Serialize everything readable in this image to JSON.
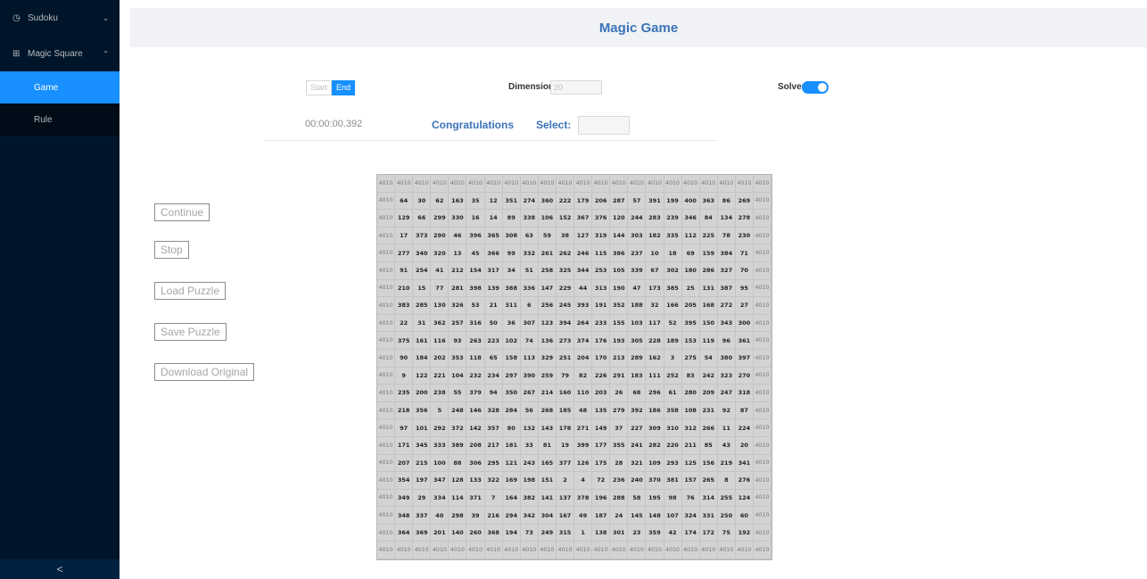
{
  "sidebar": {
    "sudoku": {
      "icon": "clock-icon",
      "glyph": "◷",
      "label": "Sudoku",
      "arrow": "⌄"
    },
    "magic_square": {
      "icon": "grid-icon",
      "glyph": "⊞",
      "label": "Magic Square",
      "arrow": "⌃"
    },
    "items": [
      {
        "label": "Game",
        "active": true
      },
      {
        "label": "Rule",
        "active": false
      }
    ],
    "collapse_glyph": "<"
  },
  "header": {
    "title": "Magic Game"
  },
  "controls": {
    "start_label": "Start",
    "end_label": "End",
    "dimension_label": "Dimension",
    "dimension_value": "20",
    "solver_label": "Solver",
    "solver_on": true,
    "timer": "00:00:00.392",
    "status": "Congratulations",
    "select_label": "Select:",
    "select_value": ""
  },
  "actions": [
    "Continue",
    "Stop",
    "Load Puzzle",
    "Save Puzzle",
    "Download Original"
  ],
  "grid": {
    "border_value": "4010",
    "rows": [
      [
        64,
        30,
        62,
        163,
        35,
        12,
        351,
        274,
        360,
        222,
        179,
        206,
        287,
        57,
        391,
        199,
        400,
        363,
        86,
        269
      ],
      [
        129,
        66,
        299,
        330,
        16,
        14,
        89,
        338,
        106,
        152,
        367,
        376,
        120,
        244,
        283,
        239,
        346,
        84,
        134,
        278
      ],
      [
        17,
        373,
        290,
        46,
        396,
        365,
        308,
        63,
        59,
        38,
        127,
        319,
        144,
        303,
        182,
        335,
        112,
        225,
        78,
        230
      ],
      [
        277,
        340,
        320,
        13,
        45,
        366,
        99,
        332,
        261,
        262,
        246,
        115,
        386,
        237,
        10,
        18,
        69,
        159,
        384,
        71
      ],
      [
        91,
        254,
        41,
        212,
        154,
        317,
        34,
        51,
        258,
        325,
        344,
        253,
        105,
        339,
        67,
        302,
        180,
        286,
        327,
        70
      ],
      [
        210,
        15,
        77,
        281,
        398,
        139,
        388,
        336,
        147,
        229,
        44,
        313,
        190,
        47,
        173,
        385,
        25,
        131,
        387,
        95
      ],
      [
        383,
        285,
        130,
        326,
        53,
        21,
        311,
        6,
        256,
        245,
        393,
        191,
        352,
        188,
        32,
        166,
        205,
        168,
        272,
        27
      ],
      [
        22,
        31,
        362,
        257,
        316,
        50,
        36,
        307,
        123,
        394,
        264,
        233,
        155,
        103,
        117,
        52,
        395,
        150,
        343,
        300
      ],
      [
        375,
        161,
        116,
        93,
        263,
        223,
        102,
        74,
        136,
        273,
        374,
        176,
        193,
        305,
        228,
        189,
        153,
        119,
        96,
        361
      ],
      [
        90,
        184,
        202,
        353,
        118,
        65,
        158,
        113,
        329,
        251,
        204,
        170,
        213,
        289,
        162,
        3,
        275,
        54,
        380,
        397
      ],
      [
        9,
        122,
        221,
        104,
        232,
        234,
        297,
        390,
        259,
        79,
        82,
        226,
        291,
        183,
        111,
        252,
        83,
        242,
        323,
        270
      ],
      [
        235,
        200,
        238,
        55,
        379,
        94,
        350,
        267,
        214,
        160,
        110,
        203,
        26,
        68,
        296,
        61,
        280,
        209,
        247,
        318
      ],
      [
        218,
        356,
        5,
        248,
        146,
        328,
        284,
        56,
        268,
        185,
        48,
        135,
        279,
        392,
        186,
        358,
        108,
        231,
        92,
        87
      ],
      [
        97,
        101,
        292,
        372,
        142,
        357,
        80,
        132,
        143,
        178,
        271,
        149,
        37,
        227,
        309,
        310,
        312,
        266,
        11,
        224
      ],
      [
        171,
        345,
        333,
        389,
        208,
        217,
        181,
        33,
        81,
        19,
        399,
        177,
        355,
        241,
        282,
        220,
        211,
        85,
        43,
        20
      ],
      [
        207,
        215,
        100,
        88,
        306,
        295,
        121,
        243,
        165,
        377,
        126,
        175,
        28,
        321,
        109,
        293,
        125,
        156,
        219,
        341
      ],
      [
        354,
        197,
        347,
        128,
        133,
        322,
        169,
        198,
        151,
        2,
        4,
        72,
        236,
        240,
        370,
        381,
        157,
        265,
        8,
        276
      ],
      [
        349,
        29,
        334,
        114,
        371,
        7,
        164,
        382,
        141,
        137,
        378,
        196,
        288,
        58,
        195,
        98,
        76,
        314,
        255,
        124
      ],
      [
        348,
        337,
        40,
        298,
        39,
        216,
        294,
        342,
        304,
        167,
        49,
        187,
        24,
        145,
        148,
        107,
        324,
        331,
        250,
        60
      ],
      [
        364,
        369,
        201,
        140,
        260,
        368,
        194,
        73,
        249,
        315,
        1,
        138,
        301,
        23,
        359,
        42,
        174,
        172,
        75,
        192
      ]
    ]
  }
}
